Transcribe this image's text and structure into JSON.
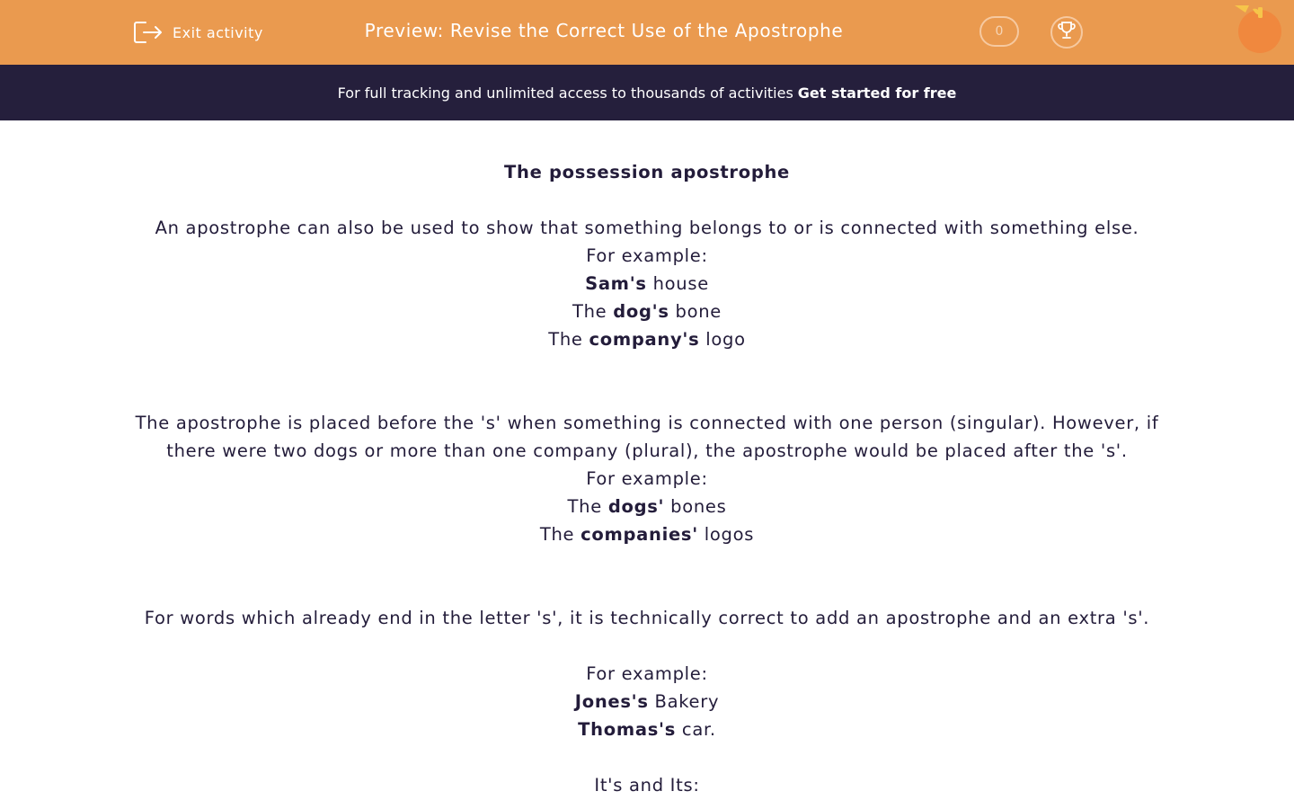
{
  "header": {
    "exit_label": "Exit activity",
    "title": "Preview: Revise the Correct Use of the Apostrophe",
    "score": "0",
    "icons": [
      "exit-icon",
      "trophy-icon",
      "orange-logo-icon"
    ]
  },
  "banner": {
    "text": "For full tracking and unlimited access to thousands of activities",
    "cta": "Get started for free"
  },
  "content": {
    "heading": "The possession apostrophe",
    "intro": "An apostrophe can also be used to show that something belongs to or is connected with something else.",
    "for_example_1": "For example:",
    "ex1": {
      "bold": "Sam's",
      "after": " house"
    },
    "ex2": {
      "before": "The ",
      "bold": "dog's",
      "after": " bone"
    },
    "ex3": {
      "before": "The ",
      "bold": "company's",
      "after": " logo"
    },
    "para2": "The apostrophe is placed before the 's' when something is connected with one person (singular). However, if there were two dogs or more than one company (plural), the apostrophe would be placed after the 's'.",
    "for_example_2": "For example:",
    "ex4": {
      "before": "The ",
      "bold": "dogs'",
      "after": " bones"
    },
    "ex5": {
      "before": "The ",
      "bold": "companies'",
      "after": " logos"
    },
    "para3": "For words which already end in the letter 's', it is technically correct to add an apostrophe and an extra 's'.",
    "for_example_3": "For example:",
    "ex6": {
      "bold": "Jones's",
      "after": " Bakery"
    },
    "ex7": {
      "bold": "Thomas's",
      "after": " car."
    },
    "subheading": "It's and Its:"
  },
  "colors": {
    "header_bg": "#ea9a4f",
    "banner_bg": "#251f3c",
    "text": "#231c3a"
  }
}
